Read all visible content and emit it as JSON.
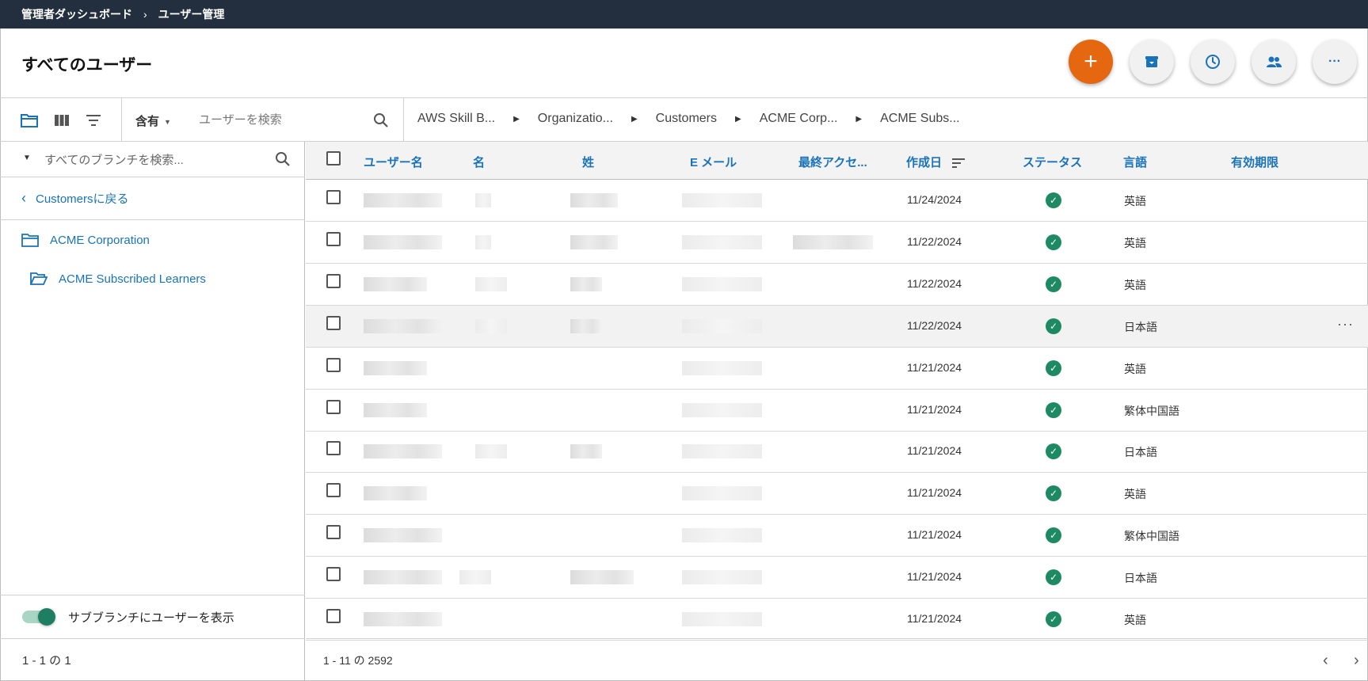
{
  "breadcrumb": {
    "root": "管理者ダッシュボード",
    "separator": "›",
    "current": "ユーザー管理"
  },
  "page": {
    "title": "すべてのユーザー"
  },
  "actions": {
    "add_label": "+",
    "more_label": "···"
  },
  "toolbar": {
    "filter_mode": "含有",
    "search_placeholder": "ユーザーを検索",
    "path": [
      "AWS Skill B...",
      "Organizatio...",
      "Customers",
      "ACME Corp...",
      "ACME Subs..."
    ]
  },
  "sidebar": {
    "search_placeholder": "すべてのブランチを検索...",
    "back_label": "Customersに戻る",
    "tree": [
      {
        "label": "ACME Corporation"
      },
      {
        "label": "ACME Subscribed Learners"
      }
    ],
    "toggle_label": "サブブランチにユーザーを表示",
    "toggle_on": true,
    "footer": "1 - 1 の 1"
  },
  "table": {
    "columns": [
      "ユーザー名",
      "名",
      "姓",
      "E メール",
      "最終アクセ...",
      "作成日",
      "ステータス",
      "言語",
      "有効期限"
    ],
    "sorted_by": "作成日",
    "rows": [
      {
        "created": "11/24/2024",
        "status": "active",
        "language": "英語"
      },
      {
        "created": "11/22/2024",
        "status": "active",
        "language": "英語"
      },
      {
        "created": "11/22/2024",
        "status": "active",
        "language": "英語"
      },
      {
        "created": "11/22/2024",
        "status": "active",
        "language": "日本語",
        "highlighted": true
      },
      {
        "created": "11/21/2024",
        "status": "active",
        "language": "英語"
      },
      {
        "created": "11/21/2024",
        "status": "active",
        "language": "繁体中国語"
      },
      {
        "created": "11/21/2024",
        "status": "active",
        "language": "日本語"
      },
      {
        "created": "11/21/2024",
        "status": "active",
        "language": "英語"
      },
      {
        "created": "11/21/2024",
        "status": "active",
        "language": "繁体中国語"
      },
      {
        "created": "11/21/2024",
        "status": "active",
        "language": "日本語"
      },
      {
        "created": "11/21/2024",
        "status": "active",
        "language": "英語"
      }
    ],
    "footer": "1 - 11 の 2592"
  },
  "colors": {
    "topbar": "#232f3e",
    "accent": "#1a73b8",
    "primary_fab": "#e5670f",
    "status_ok": "#1e8a64"
  }
}
